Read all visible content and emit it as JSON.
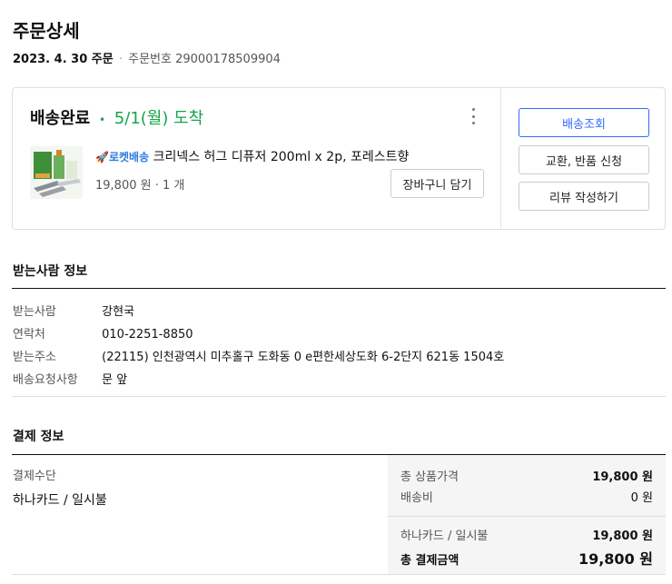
{
  "page": {
    "title": "주문상세",
    "order_date": "2023. 4. 30 주문",
    "order_number_label": "주문번호",
    "order_number": "29000178509904"
  },
  "order_card": {
    "status": "배송완료",
    "separator": "•",
    "arrival": "5/1(월) 도착",
    "product": {
      "rocket_label": "로켓배송",
      "name": "크리넥스 허그 디퓨저 200ml x 2p, 포레스트향",
      "price": "19,800 원",
      "quantity": "1 개"
    },
    "cart_button": "장바구니 담기",
    "actions": {
      "track": "배송조회",
      "exchange_return": "교환, 반품 신청",
      "write_review": "리뷰 작성하기"
    }
  },
  "recipient": {
    "section_title": "받는사람 정보",
    "rows": [
      {
        "label": "받는사람",
        "value": "강현국"
      },
      {
        "label": "연락처",
        "value": "010-2251-8850"
      },
      {
        "label": "받는주소",
        "value": "(22115) 인천광역시 미추홀구 도화동 0 e편한세상도화 6-2단지 621동 1504호"
      },
      {
        "label": "배송요청사항",
        "value": "문 앞"
      }
    ]
  },
  "payment": {
    "section_title": "결제 정보",
    "method_label": "결제수단",
    "method_value": "하나카드 / 일시불",
    "summary": {
      "product_total_label": "총 상품가격",
      "product_total_value": "19,800 원",
      "shipping_label": "배송비",
      "shipping_value": "0 원",
      "card_label": "하나카드 / 일시불",
      "card_value": "19,800 원",
      "grand_total_label": "총 결제금액",
      "grand_total_value": "19,800 원"
    }
  },
  "colors": {
    "accent_blue": "#346aff",
    "arrival_green": "#16a34a",
    "rocket_blue": "#2a7ae2"
  }
}
